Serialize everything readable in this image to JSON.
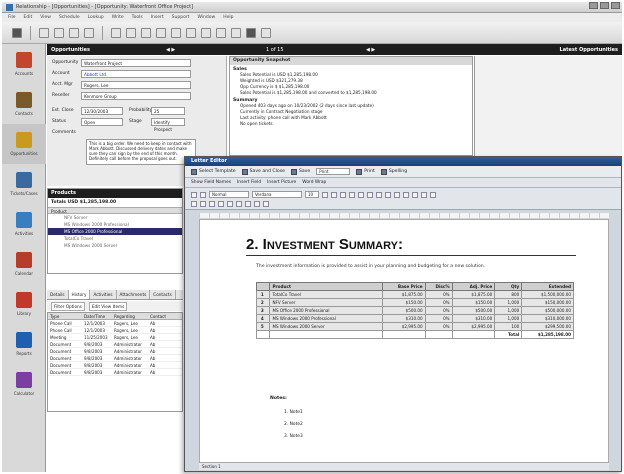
{
  "app": {
    "title": "Relationship - [Opportunities] - [Opportunity: Waterfront Office Project]"
  },
  "menu": [
    "File",
    "Edit",
    "View",
    "Schedule",
    "Lookup",
    "Write",
    "Tools",
    "Insert",
    "Support",
    "Window",
    "Help"
  ],
  "nav": [
    {
      "label": "Accounts",
      "icon": "accounts-icon",
      "color": "#c2462c"
    },
    {
      "label": "Contacts",
      "icon": "contacts-icon",
      "color": "#7a5a2a"
    },
    {
      "label": "Opportunities",
      "icon": "opportunities-icon",
      "color": "#c99a1e"
    },
    {
      "label": "Tickets/Cases",
      "icon": "tickets-icon",
      "color": "#3b6aa0"
    },
    {
      "label": "Activities",
      "icon": "activities-icon",
      "color": "#3a7ec2"
    },
    {
      "label": "Calendar",
      "icon": "calendar-icon",
      "color": "#b63c2c"
    },
    {
      "label": "Library",
      "icon": "library-icon",
      "color": "#c0392b"
    },
    {
      "label": "Reports",
      "icon": "reports-icon",
      "color": "#1f5fb0"
    },
    {
      "label": "Calculator",
      "icon": "calculator-icon",
      "color": "#7a3fa0"
    }
  ],
  "opp_header": {
    "title": "Opportunities",
    "record": "1 of 15",
    "right": "Latest Opportunities"
  },
  "form": {
    "opportunity_label": "Opportunity",
    "opportunity": "Waterfront Project",
    "account_label": "Account",
    "account": "Abbott Ltd.",
    "acct_mgr_label": "Acct. Mgr",
    "acct_mgr": "Rogers, Lee",
    "reseller_label": "Reseller",
    "reseller": "Kenmore Group",
    "est_close_label": "Est. Close",
    "est_close": "12/30/2003",
    "probability_label": "Probability",
    "probability": "25",
    "status_label": "Status",
    "status": "Open",
    "stage_label": "Stage",
    "stage": "Identify Prospect",
    "comments_label": "Comments",
    "comments": "This is a big order. We need to keep in contact with Mark Abbott. Discussed delivery dates and make sure they can sign by the end of this month. Definitely call before the proposal goes out."
  },
  "snapshot": {
    "title": "Opportunity Snapshot",
    "sales_title": "Sales",
    "sales_lines": [
      "Sales Potential is USD $1,285,198.00",
      "Weighted is USD $321,279.38",
      "Opp Currency is $ $1,285,198.00",
      "Sales Potential is $1,285,198.00 and converted to $1,285,198.00"
    ],
    "summary_title": "Summary",
    "summary_lines": [
      "Opened 403 days ago on 10/23/2002 (2 days since last update)",
      "Currently in Contract Negotiation stage",
      "Last activity: phone call with Mark Abbott",
      "No open tickets"
    ]
  },
  "products": {
    "title": "Products",
    "totals": "Totals   USD $1,285,198.00",
    "col": "Product",
    "items": [
      "NFV Server",
      "MS Windows 2000 Professional",
      "MS Office 2000 Professional",
      "TotalCo Travel",
      "MS Windows 2000 Server"
    ],
    "selected_index": 2
  },
  "tabs": [
    "Details",
    "History",
    "Activities",
    "Attachments",
    "Contacts"
  ],
  "hist_toolbar": [
    "Filter Options",
    "Edit View Items"
  ],
  "history": {
    "cols": [
      "Type",
      "Date/Time",
      "Regarding",
      "Contact"
    ],
    "rows": [
      [
        "Phone Call",
        "12/1/2003",
        "Rogers, Lee",
        "Ab"
      ],
      [
        "Phone Call",
        "12/1/2003",
        "Rogers, Lee",
        "Ab"
      ],
      [
        "Meeting",
        "11/25/2003",
        "Rogers, Lee",
        "Ab"
      ],
      [
        "Document",
        "9/8/2003",
        "Administrator",
        "Ab"
      ],
      [
        "Document",
        "9/8/2003",
        "Administrator",
        "Ab"
      ],
      [
        "Document",
        "9/8/2003",
        "Administrator",
        "Ab"
      ],
      [
        "Document",
        "9/8/2003",
        "Administrator",
        "Ab"
      ],
      [
        "Document",
        "9/8/2003",
        "Administrator",
        "Ab"
      ]
    ]
  },
  "letter": {
    "title": "Letter Editor",
    "menu": [
      "Select Template",
      "Save and Close",
      "Save",
      "Print",
      "Spelling"
    ],
    "combo": "Print",
    "bar2": [
      "Show Field Names",
      "Insert Field",
      "Insert Picture",
      "Word Wrap"
    ],
    "style": "Normal",
    "font": "Verdana",
    "size": "10",
    "heading": "2. Investment Summary:",
    "para": "The investment information is provided to assist in your planning and budgeting for a new solution.",
    "table": {
      "cols": [
        "",
        "Product",
        "Base Price",
        "Disc%",
        "Adj. Price",
        "Qty",
        "Extended"
      ],
      "rows": [
        [
          "1",
          "TotalCo Travel",
          "$1,875.00",
          "0%",
          "$1,875.00",
          "800",
          "$1,500,000.00"
        ],
        [
          "2",
          "NFV Server",
          "$150.00",
          "0%",
          "$150.00",
          "1,000",
          "$150,000.00"
        ],
        [
          "3",
          "MS Office 2000 Professional",
          "$500.00",
          "0%",
          "$500.00",
          "1,000",
          "$500,000.00"
        ],
        [
          "4",
          "MS Windows 2000 Professional",
          "$310.00",
          "0%",
          "$310.00",
          "1,000",
          "$310,000.00"
        ],
        [
          "5",
          "MS Windows 2000 Server",
          "$2,995.00",
          "0%",
          "$2,995.00",
          "100",
          "$299,500.00"
        ]
      ],
      "total_label": "Total",
      "total_value": "$1,285,198.00"
    },
    "notes_label": "Notes:",
    "notes": [
      "Note1",
      "Note2",
      "Note3"
    ],
    "note_nums": [
      "1.",
      "2.",
      "3."
    ],
    "status": "Section 1"
  }
}
